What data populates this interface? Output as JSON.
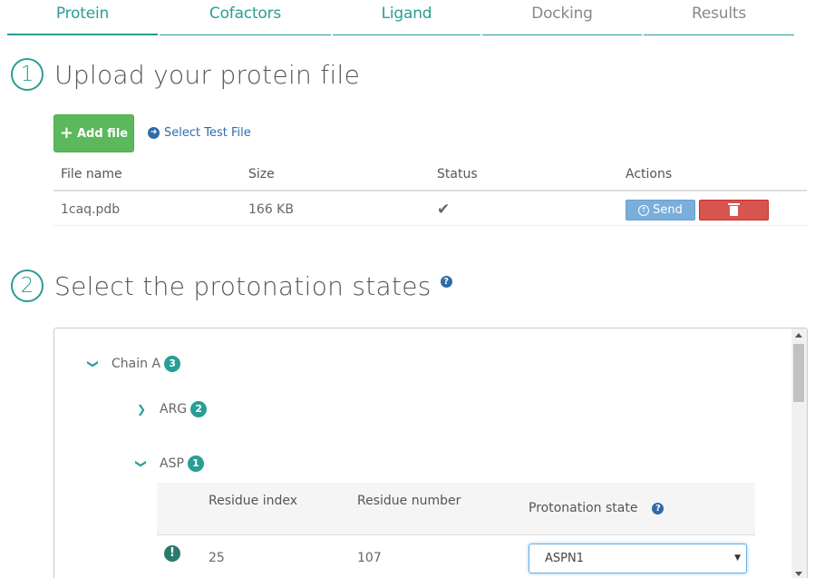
{
  "tabs": [
    {
      "label": "Protein",
      "active": true
    },
    {
      "label": "Cofactors",
      "active": false
    },
    {
      "label": "Ligand",
      "active": false
    },
    {
      "label": "Docking",
      "active": false
    },
    {
      "label": "Results",
      "active": false
    }
  ],
  "step1": {
    "number": "1",
    "title": "Upload your protein file"
  },
  "upload": {
    "add_label": "Add file",
    "test_label": "Select Test File"
  },
  "file_table": {
    "headers": [
      "File name",
      "Size",
      "Status",
      "Actions"
    ],
    "rows": [
      {
        "name": "1caq.pdb",
        "size": "166 KB",
        "status": "✔",
        "send_label": "Send"
      }
    ]
  },
  "step2": {
    "number": "2",
    "title": "Select the protonation states",
    "help": "?"
  },
  "tree": {
    "chain": {
      "label": "Chain A",
      "count": "3"
    },
    "arg": {
      "label": "ARG",
      "count": "2"
    },
    "asp": {
      "label": "ASP",
      "count": "1"
    }
  },
  "residue_table": {
    "headers": [
      "Residue index",
      "Residue number",
      "Protonation state"
    ],
    "rows": [
      {
        "index": "25",
        "number": "107",
        "state": "ASPN1"
      }
    ]
  },
  "colors": {
    "accent": "#2a9d95",
    "success": "#5cb85c",
    "danger": "#d9534f",
    "info": "#7aaedb",
    "link": "#2d6ca8"
  },
  "icons": {
    "warning": "!",
    "help": "?",
    "plus": "+",
    "arrow": "➜"
  }
}
